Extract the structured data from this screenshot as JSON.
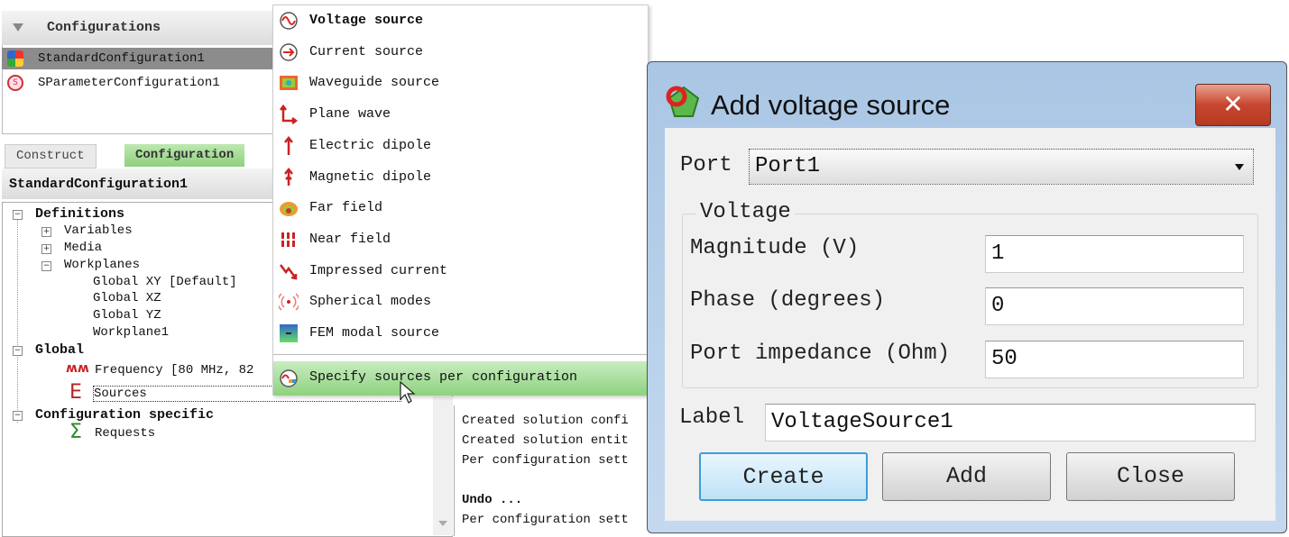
{
  "configurations": {
    "header": "Configurations",
    "items": [
      {
        "label": "StandardConfiguration1",
        "selected": true
      },
      {
        "label": "SParameterConfiguration1",
        "selected": false
      }
    ]
  },
  "tabs": [
    {
      "label": "Construct"
    },
    {
      "label": "Configuration",
      "active": true
    }
  ],
  "tree": {
    "header": "StandardConfiguration1",
    "definitions": "Definitions",
    "variables": "Variables",
    "media": "Media",
    "workplanes": "Workplanes",
    "global_xy": "Global XY [Default]",
    "global_xz": "Global XZ",
    "global_yz": "Global YZ",
    "workplane1": "Workplane1",
    "global": "Global",
    "frequency": "Frequency [80 MHz, 82",
    "sources": "Sources",
    "config_specific": "Configuration specific",
    "requests": "Requests"
  },
  "menu": {
    "items": [
      {
        "label": "Voltage source",
        "icon": "voltage-source-icon",
        "bold": true
      },
      {
        "label": "Current source",
        "icon": "current-source-icon"
      },
      {
        "label": "Waveguide source",
        "icon": "waveguide-source-icon"
      },
      {
        "label": "Plane wave",
        "icon": "plane-wave-icon"
      },
      {
        "label": "Electric dipole",
        "icon": "electric-dipole-icon"
      },
      {
        "label": "Magnetic dipole",
        "icon": "magnetic-dipole-icon"
      },
      {
        "label": "Far field",
        "icon": "far-field-icon"
      },
      {
        "label": "Near field",
        "icon": "near-field-icon"
      },
      {
        "label": "Impressed current",
        "icon": "impressed-current-icon"
      },
      {
        "label": "Spherical modes",
        "icon": "spherical-modes-icon"
      },
      {
        "label": "FEM modal source",
        "icon": "fem-modal-source-icon"
      }
    ],
    "specify": "Specify sources per configuration"
  },
  "log": {
    "lines": [
      "Created solution confi",
      "Created solution entit",
      "Per configuration sett",
      "",
      "Undo ...",
      "Per configuration sett"
    ]
  },
  "dialog": {
    "title": "Add voltage source",
    "port_label": "Port",
    "port_value": "Port1",
    "group_title": "Voltage",
    "magnitude_label": "Magnitude (V)",
    "magnitude_value": "1",
    "phase_label": "Phase (degrees)",
    "phase_value": "0",
    "impedance_label": "Port impedance (Ohm)",
    "impedance_value": "50",
    "label_label": "Label",
    "label_value": "VoltageSource1",
    "create": "Create",
    "add": "Add",
    "close": "Close",
    "close_icon": "✕"
  },
  "colors": {
    "accent_green": "#8ed27e",
    "selected_gray": "#8c8c8c",
    "dialog_frame": "#b7cfe9",
    "close_red": "#c8462f"
  }
}
